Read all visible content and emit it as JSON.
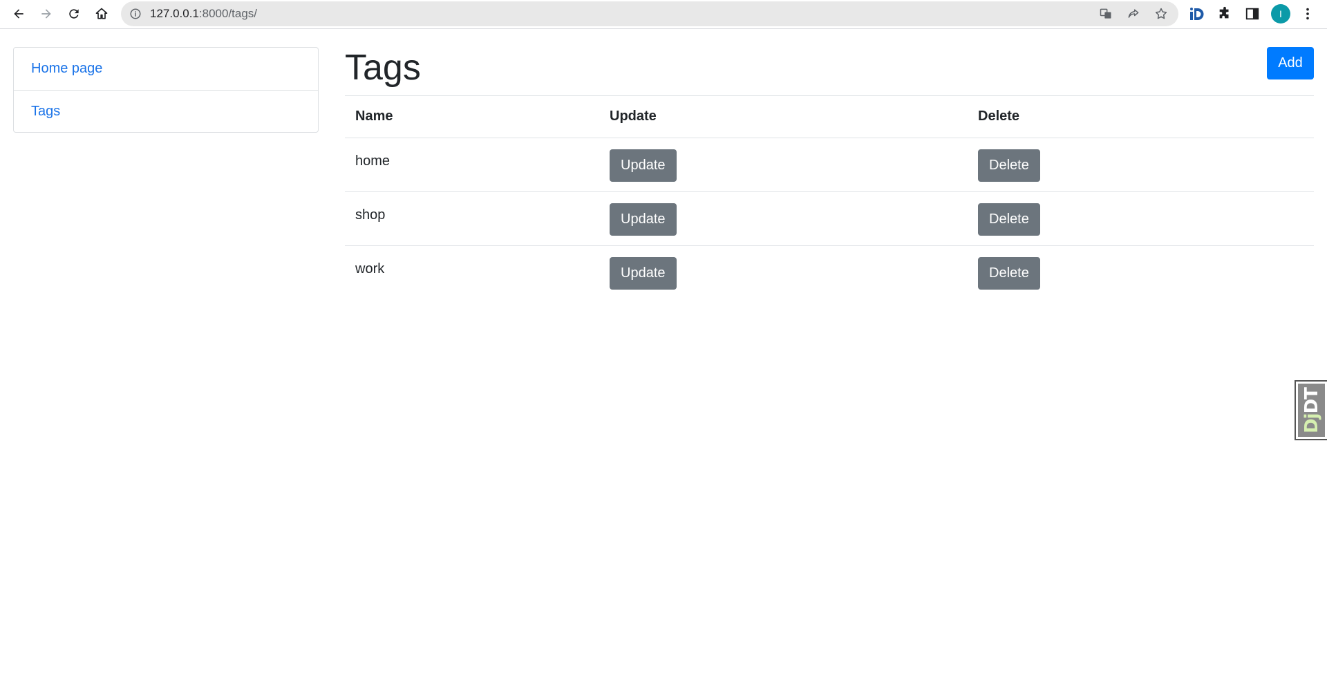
{
  "browser": {
    "url_host": "127.0.0.1",
    "url_path": ":8000/tags/",
    "profile_initial": "I"
  },
  "sidebar": {
    "items": [
      {
        "label": "Home page"
      },
      {
        "label": "Tags"
      }
    ]
  },
  "main": {
    "title": "Tags",
    "add_label": "Add",
    "columns": [
      "Name",
      "Update",
      "Delete"
    ],
    "rows": [
      {
        "name": "home",
        "update_label": "Update",
        "delete_label": "Delete"
      },
      {
        "name": "shop",
        "update_label": "Update",
        "delete_label": "Delete"
      },
      {
        "name": "work",
        "update_label": "Update",
        "delete_label": "Delete"
      }
    ]
  },
  "debug_toolbar": {
    "prefix": "Dj",
    "suffix": "DT"
  },
  "colors": {
    "link": "#1a73e8",
    "primary": "#007bff",
    "secondary": "#6c757d"
  }
}
